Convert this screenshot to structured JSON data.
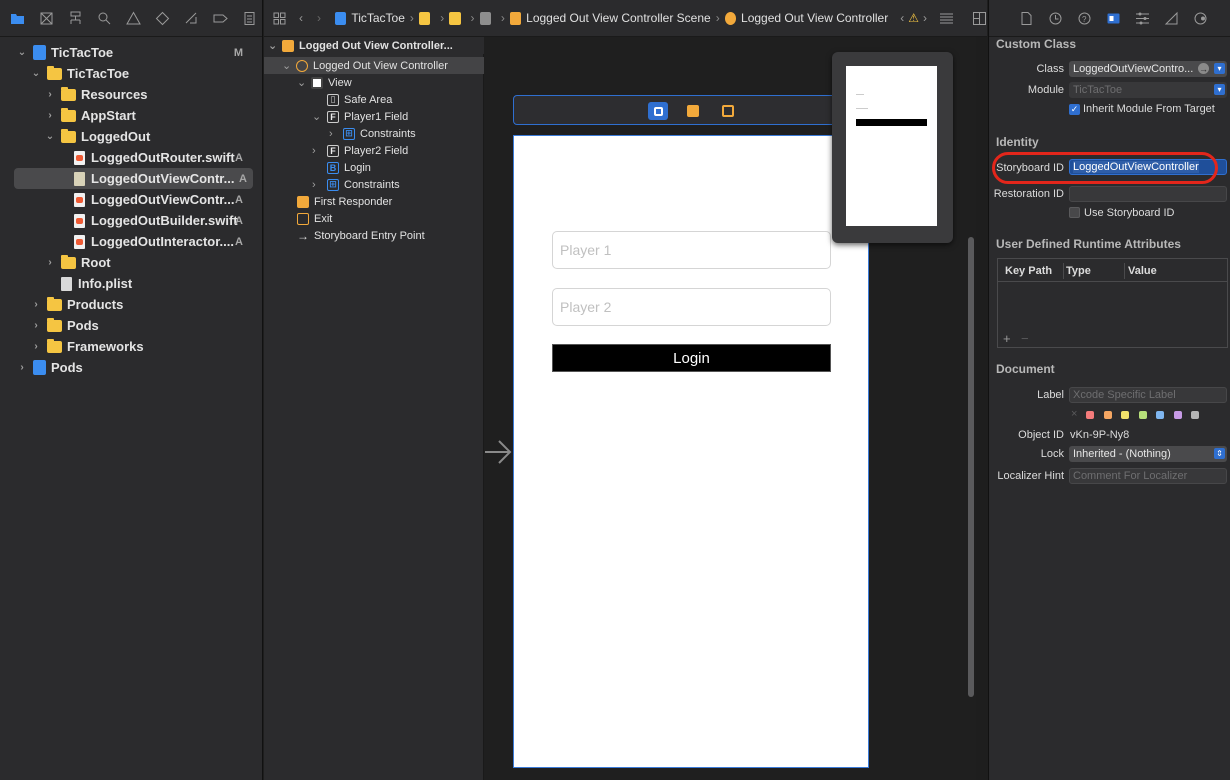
{
  "navigator": {
    "items": [
      {
        "label": "TicTacToe",
        "badge": "M"
      },
      {
        "label": "TicTacToe"
      },
      {
        "label": "Resources"
      },
      {
        "label": "AppStart"
      },
      {
        "label": "LoggedOut"
      },
      {
        "label": "LoggedOutRouter.swift",
        "badge": "A"
      },
      {
        "label": "LoggedOutViewContr...",
        "badge": "A"
      },
      {
        "label": "LoggedOutViewContr...",
        "badge": "A"
      },
      {
        "label": "LoggedOutBuilder.swift",
        "badge": "A"
      },
      {
        "label": "LoggedOutInteractor....",
        "badge": "A"
      },
      {
        "label": "Root"
      },
      {
        "label": "Info.plist"
      },
      {
        "label": "Products"
      },
      {
        "label": "Pods"
      },
      {
        "label": "Frameworks"
      },
      {
        "label": "Pods"
      }
    ]
  },
  "jumpbar": {
    "crumbs": [
      "TicTacToe",
      "Logged Out View Controller Scene",
      "Logged Out View Controller"
    ]
  },
  "outline": {
    "items": [
      {
        "label": "Logged Out View Controller..."
      },
      {
        "label": "Logged Out View Controller"
      },
      {
        "label": "View"
      },
      {
        "label": "Safe Area"
      },
      {
        "label": "Player1 Field"
      },
      {
        "label": "Constraints"
      },
      {
        "label": "Player2 Field"
      },
      {
        "label": "Login"
      },
      {
        "label": "Constraints"
      },
      {
        "label": "First Responder"
      },
      {
        "label": "Exit"
      },
      {
        "label": "Storyboard Entry Point"
      }
    ]
  },
  "canvas": {
    "player1_placeholder": "Player 1",
    "player2_placeholder": "Player 2",
    "login_label": "Login"
  },
  "inspector": {
    "custom_class": {
      "title": "Custom Class",
      "class_label": "Class",
      "class_value": "LoggedOutViewContro...",
      "module_label": "Module",
      "module_value": "TicTacToe",
      "inherit_label": "Inherit Module From Target"
    },
    "identity": {
      "title": "Identity",
      "storyboard_id_label": "Storyboard ID",
      "storyboard_id_value": "LoggedOutViewController",
      "restoration_id_label": "Restoration ID",
      "use_storyboard_id_label": "Use Storyboard ID"
    },
    "runtime": {
      "title": "User Defined Runtime Attributes",
      "columns": [
        "Key Path",
        "Type",
        "Value"
      ],
      "add": "+",
      "remove": "−"
    },
    "document": {
      "title": "Document",
      "label_label": "Label",
      "label_placeholder": "Xcode Specific Label",
      "colors": [
        "#f47b7b",
        "#f5a662",
        "#f2e26b",
        "#b7e07a",
        "#7fb6f0",
        "#c79ae6",
        "#b5b5b5"
      ],
      "object_id_label": "Object ID",
      "object_id_value": "vKn-9P-Ny8",
      "lock_label": "Lock",
      "lock_value": "Inherited - (Nothing)",
      "localizer_label": "Localizer Hint",
      "localizer_placeholder": "Comment For Localizer"
    }
  },
  "colors": {
    "accent": "#2f6fd0",
    "annotation": "#e3261b",
    "folder": "#f5c542"
  }
}
